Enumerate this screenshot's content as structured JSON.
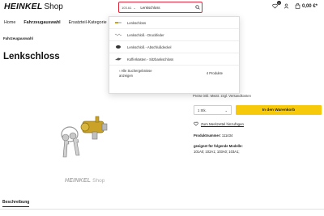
{
  "header": {
    "logo_mark": "HEINKEL",
    "logo_shop": "Shop",
    "wishlist_count": "0",
    "cart_total": "0,00 €*"
  },
  "nav": {
    "items": [
      "Home",
      "Fahrzeugauswahl",
      "Ersatzteil-Kategorie"
    ]
  },
  "breadcrumb": "Fahrzeugauswahl",
  "page_title": "Lenkschloss",
  "search": {
    "model_value": "103 A1",
    "query": "Lenkschloss"
  },
  "dropdown": {
    "suggestions": [
      "Lenkschloss",
      "Lenkschloß - Druckfeder",
      "Lenkschloß - Abschlußdeckel",
      "Kofferkästen - Sitzbankschloss"
    ],
    "all_results_line1": "Alle Suchergebnisse",
    "all_results_line2": "anzeigen",
    "result_count": "4 Produkte"
  },
  "product": {
    "price_note": "Preise inkl. MwSt. zzgl. Versandkosten",
    "qty_value": "1 Stk.",
    "add_to_cart": "In den Warenkorb",
    "wishlist_label": "Zum Merkzettel hinzufügen",
    "prodnum_label": "Produktnummer:",
    "prodnum_value": "111434",
    "models_label": "geeignet für folgende Modelle:",
    "models_value": "101A0; 102A1; 103A0; 103A1;"
  },
  "image_logo": {
    "mark": "HEINKEL",
    "shop": "Shop"
  },
  "tabs": {
    "description": "Beschreibung"
  },
  "colors": {
    "accent_yellow": "#f6c90a",
    "search_border": "#e3253a"
  }
}
